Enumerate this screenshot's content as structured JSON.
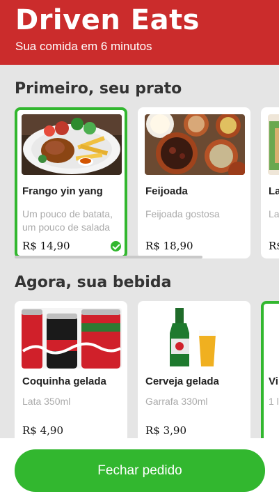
{
  "header": {
    "brand": "Driven Eats",
    "tagline": "Sua comida em 6 minutos"
  },
  "sections": [
    {
      "title": "Primeiro, seu prato",
      "items": [
        {
          "name": "Frango yin yang",
          "desc": "Um pouco de batata, um pouco de salada",
          "price": "R$ 14,90",
          "selected": true,
          "image": "chicken-fries-salad-photo"
        },
        {
          "name": "Feijoada",
          "desc": "Feijoada gostosa",
          "price": "R$ 18,90",
          "selected": false,
          "image": "feijoada-pots-photo"
        },
        {
          "name": "La",
          "desc": "La",
          "price": "R$",
          "selected": false,
          "image": "lasagna-photo"
        }
      ]
    },
    {
      "title": "Agora, sua bebida",
      "items": [
        {
          "name": "Coquinha gelada",
          "desc": "Lata 350ml",
          "price": "R$ 4,90",
          "selected": false,
          "image": "coca-cola-cans-photo"
        },
        {
          "name": "Cerveja gelada",
          "desc": "Garrafa 330ml",
          "price": "R$ 3,90",
          "selected": false,
          "image": "beer-bottle-glass-photo"
        },
        {
          "name": "Vi",
          "desc": "1 l",
          "price": "",
          "selected": true,
          "image": "wine-photo"
        }
      ]
    }
  ],
  "footer": {
    "button_label": "Fechar pedido"
  },
  "colors": {
    "header": "#cb2c2c",
    "accent": "#32b72f",
    "background": "#e5e5e5"
  }
}
